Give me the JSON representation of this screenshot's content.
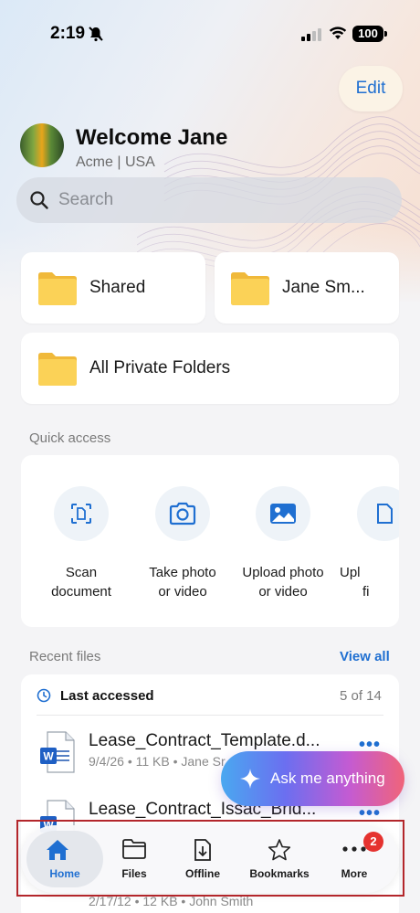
{
  "status": {
    "time": "2:19",
    "battery": "100"
  },
  "header": {
    "edit_label": "Edit",
    "welcome": "Welcome Jane",
    "org": "Acme | USA"
  },
  "search": {
    "placeholder": "Search"
  },
  "folders": [
    {
      "label": "Shared"
    },
    {
      "label": "Jane Sm..."
    },
    {
      "label": "All Private Folders"
    }
  ],
  "quick_access": {
    "title": "Quick access",
    "items": [
      {
        "label": "Scan document",
        "icon": "scan-document-icon"
      },
      {
        "label": "Take photo or video",
        "icon": "camera-icon"
      },
      {
        "label": "Upload photo or video",
        "icon": "image-upload-icon"
      },
      {
        "label": "Upl fi",
        "icon": "file-upload-icon"
      }
    ]
  },
  "recent": {
    "title": "Recent files",
    "view_all": "View all",
    "subtitle": "Last accessed",
    "count": "5 of 14",
    "files": [
      {
        "name": "Lease_Contract_Template.d...",
        "meta": "9/4/26 • 11 KB • Jane Sr"
      },
      {
        "name": "Lease_Contract_Issac_Brid...",
        "meta": ""
      },
      {
        "name": "",
        "meta": "2/17/12 • 12 KB • John Smith"
      }
    ]
  },
  "ask": {
    "label": "Ask me anything"
  },
  "tabbar": {
    "tabs": [
      {
        "label": "Home",
        "icon": "home-icon",
        "active": true
      },
      {
        "label": "Files",
        "icon": "folder-icon"
      },
      {
        "label": "Offline",
        "icon": "offline-download-icon"
      },
      {
        "label": "Bookmarks",
        "icon": "star-icon"
      },
      {
        "label": "More",
        "icon": "more-icon"
      }
    ],
    "more_badge": "2"
  },
  "colors": {
    "accent": "#1f6fd1",
    "folder": "#f7c948",
    "badge": "#e5322f"
  }
}
